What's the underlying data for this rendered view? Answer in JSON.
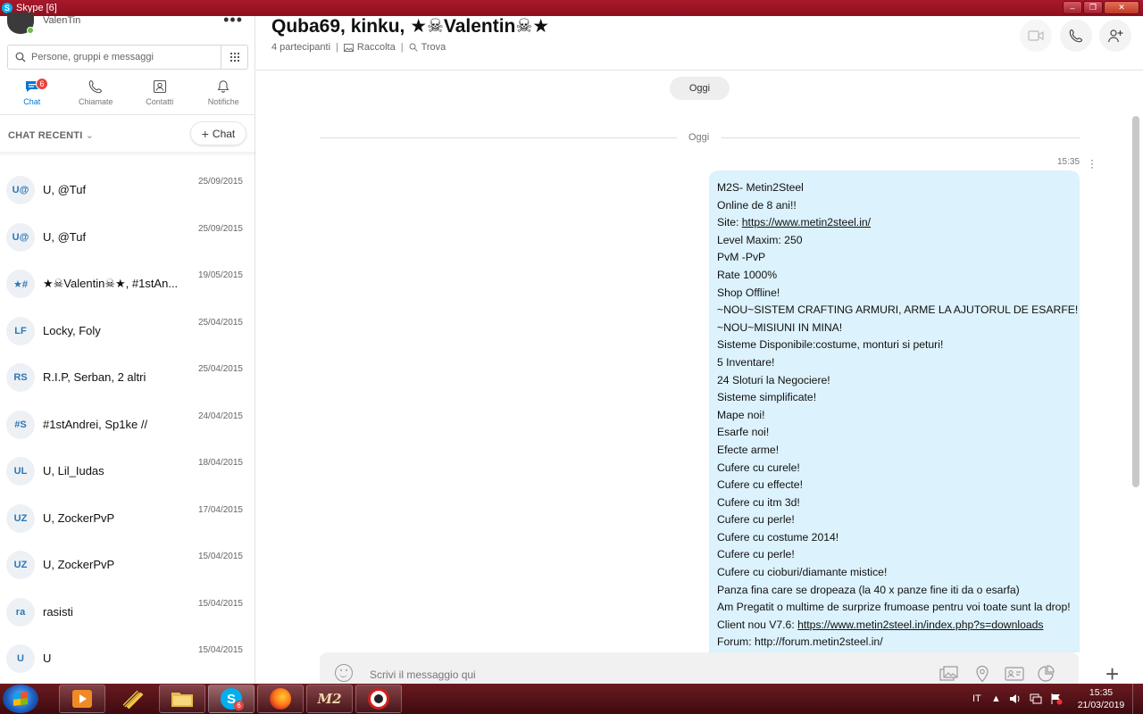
{
  "window": {
    "title": "Skype [6]",
    "controls": [
      "minimize",
      "restore",
      "close"
    ]
  },
  "profile": {
    "name": "ValenTin",
    "status_color": "#6bbd45"
  },
  "search": {
    "placeholder": "Persone, gruppi e messaggi"
  },
  "nav": {
    "tabs": [
      {
        "label": "Chat",
        "icon": "chat-icon",
        "badge": "6",
        "active": true
      },
      {
        "label": "Chiamate",
        "icon": "phone-icon"
      },
      {
        "label": "Contatti",
        "icon": "contacts-icon"
      },
      {
        "label": "Notifiche",
        "icon": "bell-icon"
      }
    ]
  },
  "recents": {
    "header": "CHAT RECENTI",
    "new_chat_label": "Chat",
    "items": [
      {
        "initials": "U@",
        "name": "U, @Tuf",
        "date": "25/09/2015"
      },
      {
        "initials": "U@",
        "name": "U, @Tuf",
        "date": "25/09/2015"
      },
      {
        "initials": "★#",
        "name": "★☠Valentin☠★, #1stAn...",
        "date": "19/05/2015"
      },
      {
        "initials": "LF",
        "name": "Locky, Foly",
        "date": "25/04/2015"
      },
      {
        "initials": "RS",
        "name": "R.I.P, Serban, 2 altri",
        "date": "25/04/2015"
      },
      {
        "initials": "#S",
        "name": "#1stAndrei, Sp1ke //",
        "date": "24/04/2015"
      },
      {
        "initials": "UL",
        "name": "U, Lil_Iudas",
        "date": "18/04/2015"
      },
      {
        "initials": "UZ",
        "name": "U, ZockerPvP",
        "date": "17/04/2015"
      },
      {
        "initials": "UZ",
        "name": "U, ZockerPvP",
        "date": "15/04/2015"
      },
      {
        "initials": "ra",
        "name": "rasisti",
        "date": "15/04/2015"
      },
      {
        "initials": "U",
        "name": "U",
        "date": "15/04/2015"
      }
    ]
  },
  "conversation": {
    "title": "Quba69, kinku, ★☠Valentin☠★",
    "participants": "4 partecipanti",
    "gallery": "Raccolta",
    "find": "Trova",
    "today_pill": "Oggi",
    "today_divider": "Oggi",
    "message": {
      "time": "15:35",
      "lines": [
        {
          "text": "M2S- Metin2Steel"
        },
        {
          "text": "Online de 8 ani!!"
        },
        {
          "prefix": "Site: ",
          "link": "https://www.metin2steel.in/"
        },
        {
          "text": "Level Maxim: 250"
        },
        {
          "text": "PvM -PvP"
        },
        {
          "text": "Rate 1000%"
        },
        {
          "text": "Shop Offline!"
        },
        {
          "text": "~NOU~SISTEM CRAFTING ARMURI, ARME LA AJUTORUL DE ESARFE!"
        },
        {
          "text": "~NOU~MISIUNI IN MINA!"
        },
        {
          "text": "Sisteme Disponibile:costume, monturi si peturi!"
        },
        {
          "text": "5 Inventare!"
        },
        {
          "text": "24 Sloturi la Negociere!"
        },
        {
          "text": "Sisteme simplificate!"
        },
        {
          "text": "Mape noi!"
        },
        {
          "text": "Esarfe noi!"
        },
        {
          "text": "Efecte arme!"
        },
        {
          "text": "Cufere cu curele!"
        },
        {
          "text": "Cufere cu effecte!"
        },
        {
          "text": "Cufere cu itm 3d!"
        },
        {
          "text": "Cufere cu perle!"
        },
        {
          "text": "Cufere cu costume 2014!"
        },
        {
          "text": "Cufere cu perle!"
        },
        {
          "text": "Cufere cu cioburi/diamante mistice!"
        },
        {
          "text": "Panza fina care se dropeaza (la 40 x panze fine iti da o esarfa)"
        },
        {
          "text": "Am Pregatit o multime de surprize frumoase pentru voi toate sunt la drop!"
        },
        {
          "prefix": "Client nou V7.6: ",
          "link": "https://www.metin2steel.in/index.php?s=downloads"
        },
        {
          "text": "Forum: http://forum.metin2steel.in/"
        }
      ]
    }
  },
  "compose": {
    "placeholder": "Scrivi il messaggio qui"
  },
  "taskbar": {
    "language": "IT",
    "time": "15:35",
    "date": "21/03/2019",
    "skype_badge": "6"
  },
  "colors": {
    "accent": "#0078d4",
    "bubble": "#dcf2fc",
    "badge": "#e8433d",
    "titlebar": "#a8182a"
  }
}
